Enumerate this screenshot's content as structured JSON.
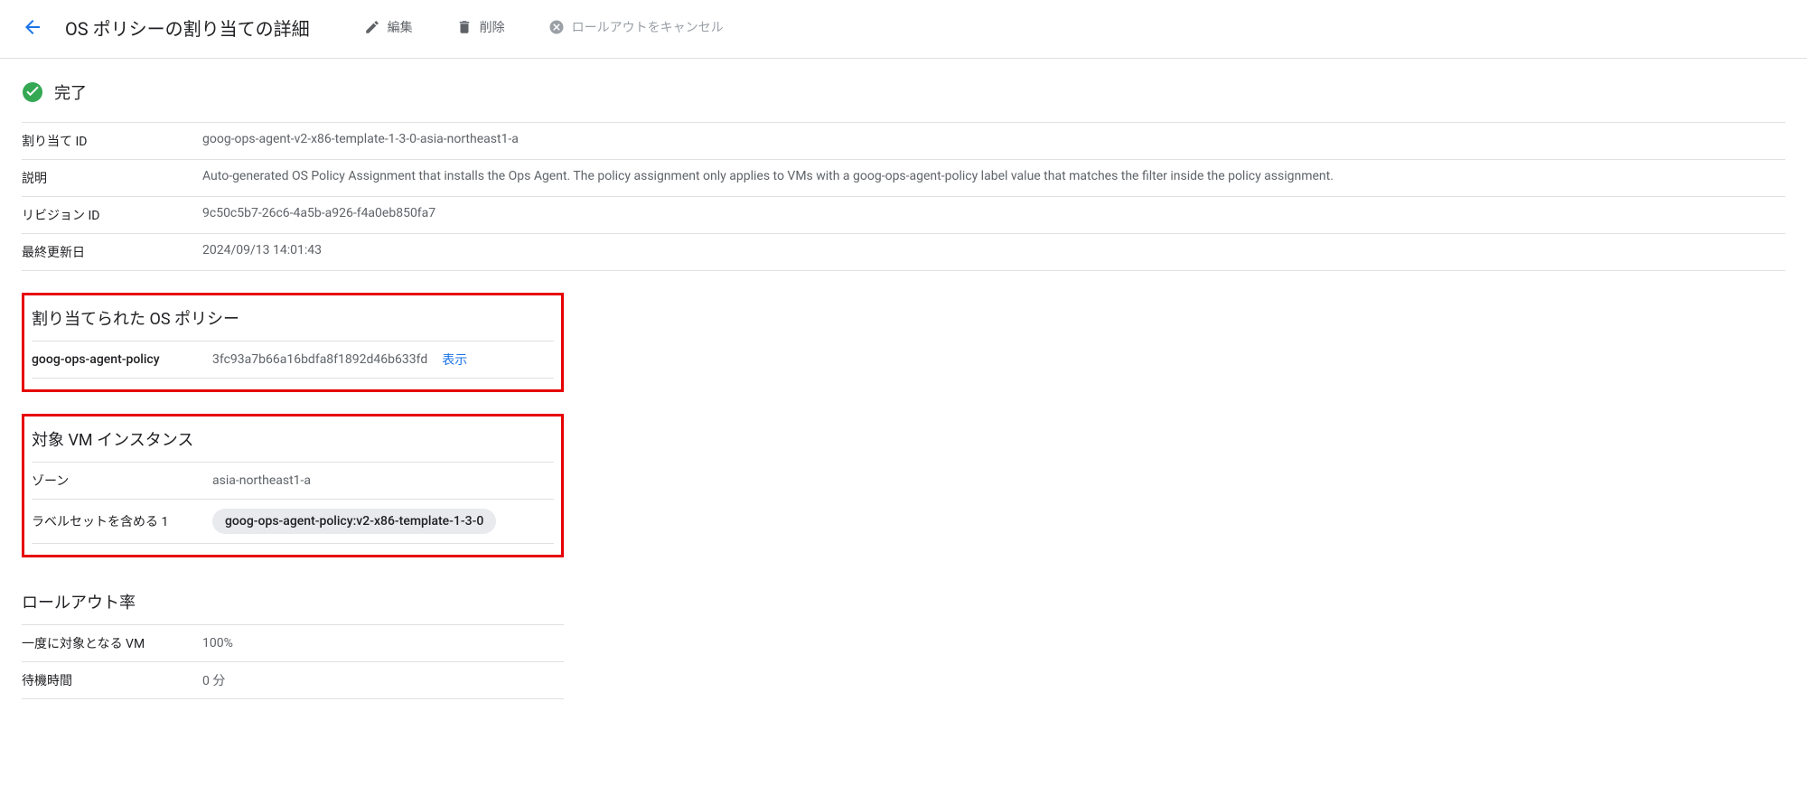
{
  "header": {
    "title": "OS ポリシーの割り当ての詳細",
    "edit_label": "編集",
    "delete_label": "削除",
    "cancel_label": "ロールアウトをキャンセル"
  },
  "status": {
    "text": "完了"
  },
  "details": {
    "assignment_id_label": "割り当て ID",
    "assignment_id_value": "goog-ops-agent-v2-x86-template-1-3-0-asia-northeast1-a",
    "description_label": "説明",
    "description_value": "Auto-generated OS Policy Assignment that installs the Ops Agent. The policy assignment only applies to VMs with a goog-ops-agent-policy label value that matches the filter inside the policy assignment.",
    "revision_id_label": "リビジョン ID",
    "revision_id_value": "9c50c5b7-26c6-4a5b-a926-f4a0eb850fa7",
    "last_updated_label": "最終更新日",
    "last_updated_value": "2024/09/13 14:01:43"
  },
  "assigned_policies": {
    "title": "割り当てられた OS ポリシー",
    "policy_name": "goog-ops-agent-policy",
    "policy_hash": "3fc93a7b66a16bdfa8f1892d46b633fd",
    "show_label": "表示"
  },
  "target_vm": {
    "title": "対象 VM インスタンス",
    "zone_label": "ゾーン",
    "zone_value": "asia-northeast1-a",
    "labelset_label": "ラベルセットを含める 1",
    "labelset_chip": "goog-ops-agent-policy:v2-x86-template-1-3-0"
  },
  "rollout": {
    "title": "ロールアウト率",
    "vm_at_once_label": "一度に対象となる VM",
    "vm_at_once_value": "100%",
    "wait_time_label": "待機時間",
    "wait_time_value": "0 分"
  }
}
